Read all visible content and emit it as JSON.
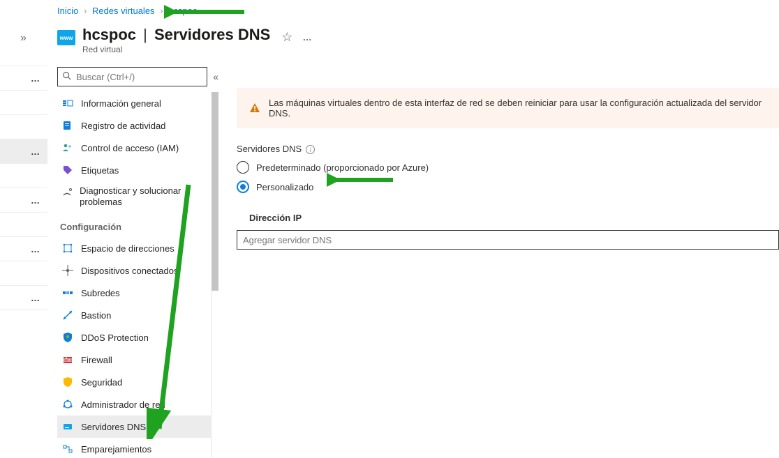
{
  "breadcrumb": {
    "items": [
      {
        "label": "Inicio"
      },
      {
        "label": "Redes virtuales"
      },
      {
        "label": "hcspoc"
      }
    ]
  },
  "header": {
    "resource_name": "hcspoc",
    "page_title": "Servidores DNS",
    "resource_type": "Red virtual",
    "res_icon_text": "www"
  },
  "search": {
    "placeholder": "Buscar (Ctrl+/)"
  },
  "nav": {
    "items": [
      {
        "label": "Información general"
      },
      {
        "label": "Registro de actividad"
      },
      {
        "label": "Control de acceso (IAM)"
      },
      {
        "label": "Etiquetas"
      },
      {
        "label": "Diagnosticar y solucionar problemas"
      }
    ],
    "section_config": "Configuración",
    "config_items": [
      {
        "label": "Espacio de direcciones"
      },
      {
        "label": "Dispositivos conectados"
      },
      {
        "label": "Subredes"
      },
      {
        "label": "Bastion"
      },
      {
        "label": "DDoS Protection"
      },
      {
        "label": "Firewall"
      },
      {
        "label": "Seguridad"
      },
      {
        "label": "Administrador de red"
      },
      {
        "label": "Servidores DNS"
      },
      {
        "label": "Emparejamientos"
      }
    ]
  },
  "content": {
    "warning": "Las máquinas virtuales dentro de esta interfaz de red se deben reiniciar para usar la configuración actualizada del servidor DNS.",
    "field_label": "Servidores DNS",
    "radio_default": "Predeterminado (proporcionado por Azure)",
    "radio_custom": "Personalizado",
    "ip_heading": "Dirección IP",
    "ip_placeholder": "Agregar servidor DNS"
  }
}
